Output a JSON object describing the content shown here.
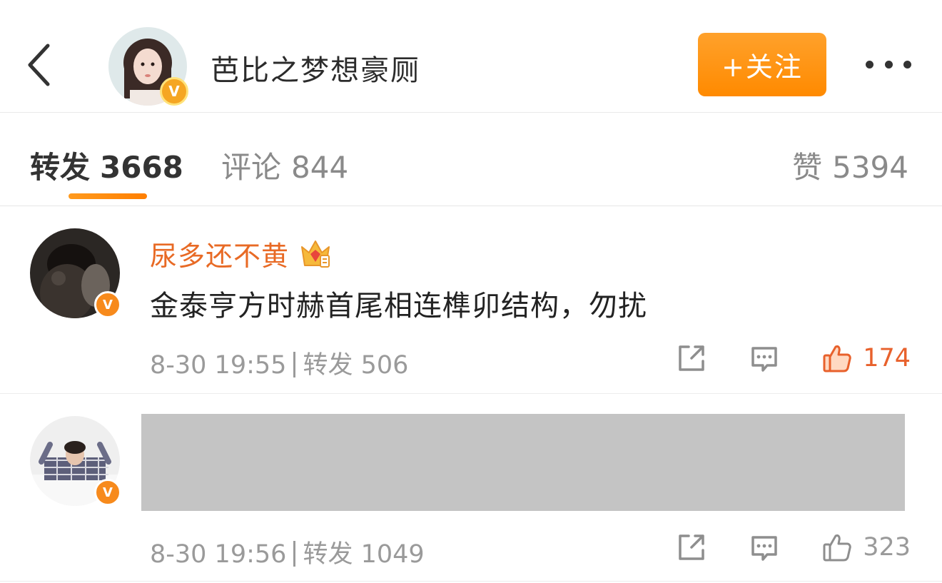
{
  "header": {
    "title": "芭比之梦想豪厕",
    "verified_badge": "V",
    "follow_label": "+关注",
    "back_icon": "chevron-left-icon",
    "more_icon": "more-dots-icon"
  },
  "tabs": {
    "repost": {
      "label": "转发",
      "count": "3668"
    },
    "comment": {
      "label": "评论",
      "count": "844"
    },
    "like": {
      "label": "赞",
      "count": "5394"
    }
  },
  "posts": [
    {
      "username": "尿多还不黄",
      "member_icon": "vip-crown-icon",
      "verified_badge": "V",
      "content": "金泰亨方时赫首尾相连榫卯结构，勿扰",
      "time": "8-30 19:55",
      "repost_label": "转发",
      "repost_count": "506",
      "like_count": "174",
      "liked": true
    },
    {
      "verified_badge": "V",
      "content_redacted": true,
      "time": "8-30 19:56",
      "repost_label": "转发",
      "repost_count": "1049",
      "like_count": "323",
      "liked": false
    }
  ],
  "colors": {
    "accent": "#ff8a00",
    "username": "#e86a25",
    "liked": "#e8612c",
    "meta": "#9a9a9a",
    "redacted": "#c4c4c4"
  }
}
